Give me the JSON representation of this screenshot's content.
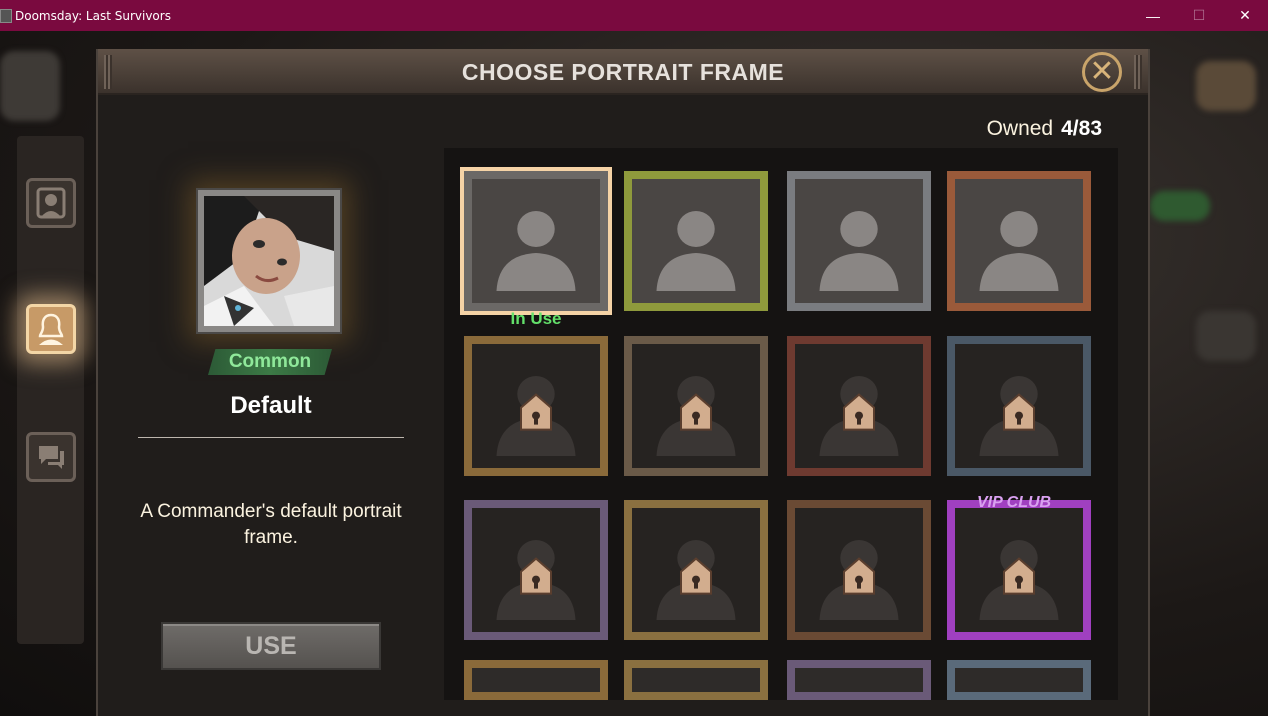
{
  "window": {
    "title": "Doomsday: Last Survivors",
    "minimize_glyph": "—",
    "maximize_glyph": "☐",
    "close_glyph": "✕"
  },
  "dialog": {
    "title": "CHOOSE PORTRAIT FRAME",
    "close_icon": "close-x-icon"
  },
  "sidebar": {
    "items": [
      {
        "name": "portrait-frame",
        "icon": "portrait-frame-icon",
        "active": false
      },
      {
        "name": "avatar",
        "icon": "person-silhouette-icon",
        "active": true
      },
      {
        "name": "chat-bubble",
        "icon": "chat-bubble-icon",
        "active": false
      }
    ]
  },
  "selected_frame": {
    "rarity": "Common",
    "name": "Default",
    "description": "A Commander's default portrait frame.",
    "use_label": "USE"
  },
  "owned": {
    "label": "Owned",
    "count": "4/83"
  },
  "frames": [
    {
      "id": "default",
      "owned": true,
      "status": "In Use",
      "color": "#6b6866"
    },
    {
      "id": "frog",
      "owned": true,
      "color": "#8f9a3c"
    },
    {
      "id": "cobweb",
      "owned": true,
      "color": "#7a7c80"
    },
    {
      "id": "copper-gear",
      "owned": true,
      "color": "#9a5a3a"
    },
    {
      "id": "handshake-banner",
      "owned": false,
      "color": "#8a6a3a"
    },
    {
      "id": "rifle",
      "owned": false,
      "color": "#6a5a48"
    },
    {
      "id": "red-skull-grenade",
      "owned": false,
      "color": "#6e3a30"
    },
    {
      "id": "blue-skull-motorbike",
      "owned": false,
      "color": "#4a5866"
    },
    {
      "id": "purple-skull-tank",
      "owned": false,
      "color": "#6a5a78"
    },
    {
      "id": "gold-mask-jet",
      "owned": false,
      "color": "#8a7040"
    },
    {
      "id": "wood-dog",
      "owned": false,
      "color": "#6a4a34"
    },
    {
      "id": "vip-club",
      "owned": false,
      "label": "VIP CLUB",
      "color": "#a040c0"
    }
  ]
}
